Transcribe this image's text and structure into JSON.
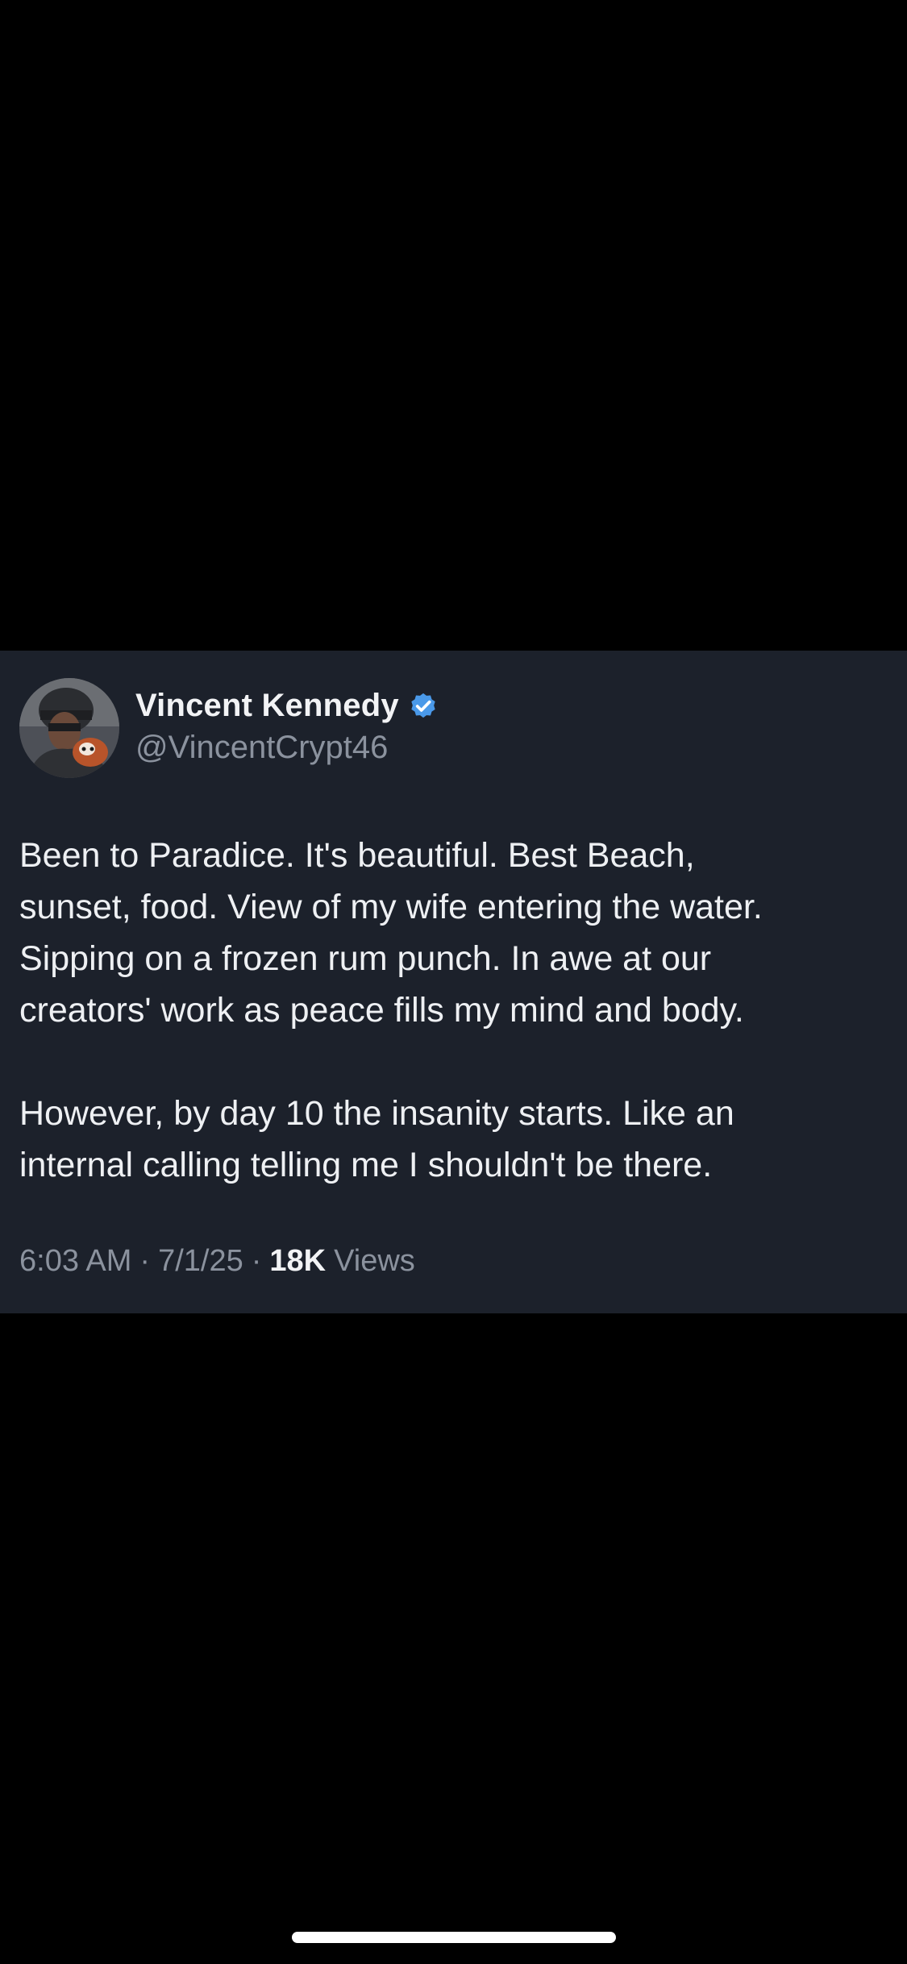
{
  "tweet": {
    "author": {
      "display_name": "Vincent Kennedy",
      "handle": "@VincentCrypt46",
      "verified": true,
      "verified_color": "#4a99e9"
    },
    "paragraphs": [
      {
        "lines": [
          "Been to Paradice. It's beautiful. Best Beach,",
          "sunset, food. View of my wife entering the water.",
          "Sipping on a frozen rum punch. In awe at our",
          "creators' work as peace fills my mind and body."
        ]
      },
      {
        "lines": [
          "However, by day 10 the insanity starts. Like an",
          "internal calling telling me I shouldn't be there."
        ]
      }
    ],
    "meta": {
      "time": "6:03 AM",
      "separator": "·",
      "date": "7/1/25",
      "views_count": "18K",
      "views_label": "Views"
    }
  },
  "colors": {
    "background": "#000000",
    "card_background": "#1c212b",
    "text_primary": "#eef0f3",
    "text_secondary": "#8b929e"
  },
  "icons": {
    "avatar": "avatar-photo",
    "verified": "verified-badge-icon",
    "home_indicator": "home-indicator-bar"
  }
}
